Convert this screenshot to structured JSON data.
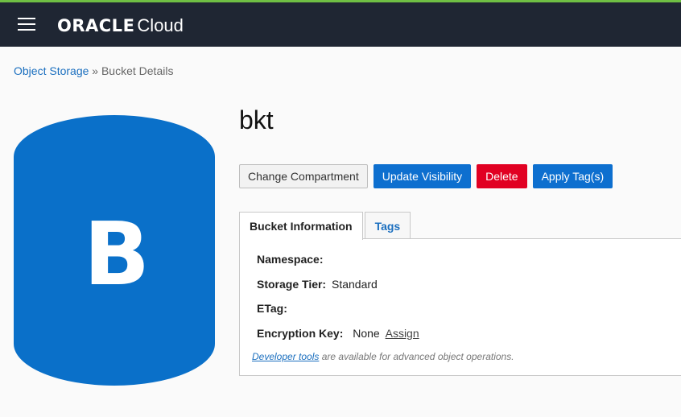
{
  "header": {
    "brand_oracle": "ORACLE",
    "brand_cloud": "Cloud"
  },
  "breadcrumb": {
    "parent": "Object Storage",
    "separator": "»",
    "current": "Bucket Details"
  },
  "bucket": {
    "icon_letter": "B",
    "name": "bkt"
  },
  "actions": {
    "change_compartment": "Change Compartment",
    "update_visibility": "Update Visibility",
    "delete": "Delete",
    "apply_tags": "Apply Tag(s)"
  },
  "tabs": [
    {
      "label": "Bucket Information"
    },
    {
      "label": "Tags"
    }
  ],
  "info": {
    "namespace_label": "Namespace:",
    "namespace_value": "",
    "storage_tier_label": "Storage Tier:",
    "storage_tier_value": "Standard",
    "etag_label": "ETag:",
    "etag_value": "",
    "encryption_key_label": "Encryption Key:",
    "encryption_key_value": "None",
    "encryption_key_assign": "Assign"
  },
  "dev_note": {
    "link": "Developer tools",
    "text": " are available for advanced object operations."
  },
  "colors": {
    "topbar": "#1f2633",
    "accent_green": "#6fbf44",
    "primary_blue": "#0d6fcf",
    "danger_red": "#e10022",
    "bucket_blue": "#0a70c9"
  }
}
